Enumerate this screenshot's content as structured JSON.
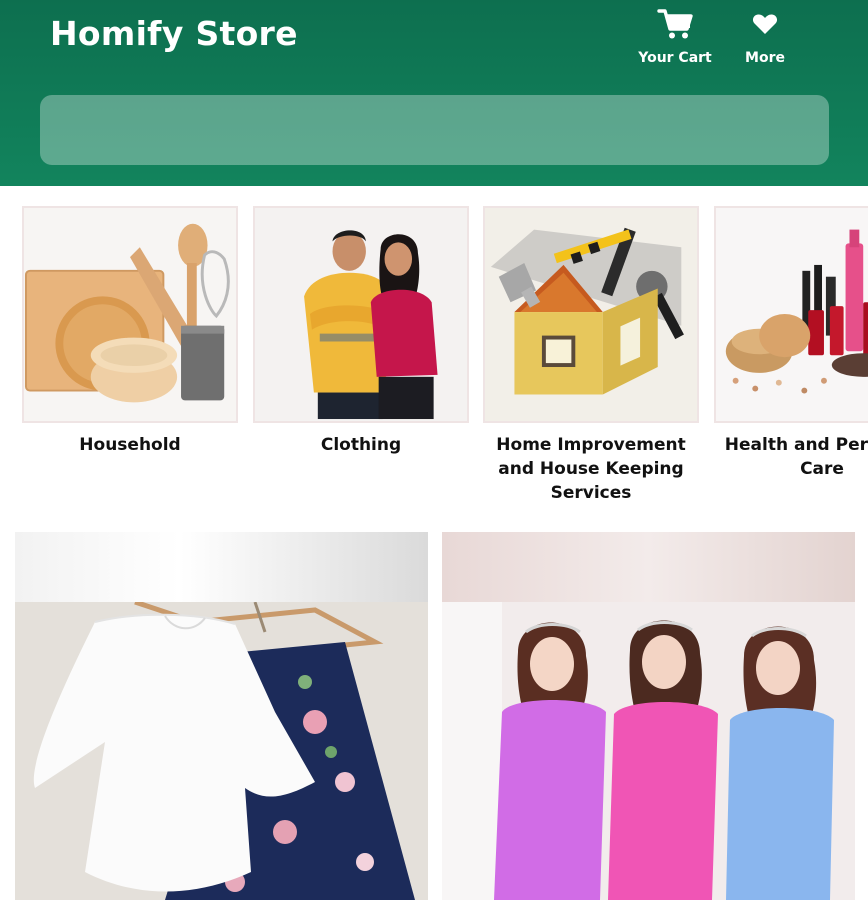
{
  "header": {
    "brand": "Homify Store",
    "cart_label": "Your Cart",
    "more_label": "More",
    "cart_icon": "cart-icon",
    "more_icon": "heart-icon",
    "color": "#0d6f4f"
  },
  "search": {
    "value": "",
    "placeholder": ""
  },
  "categories": [
    {
      "label": "Household"
    },
    {
      "label": "Clothing"
    },
    {
      "label": "Home Improvement and House Keeping Services"
    },
    {
      "label": "Health and Personal Care"
    }
  ]
}
